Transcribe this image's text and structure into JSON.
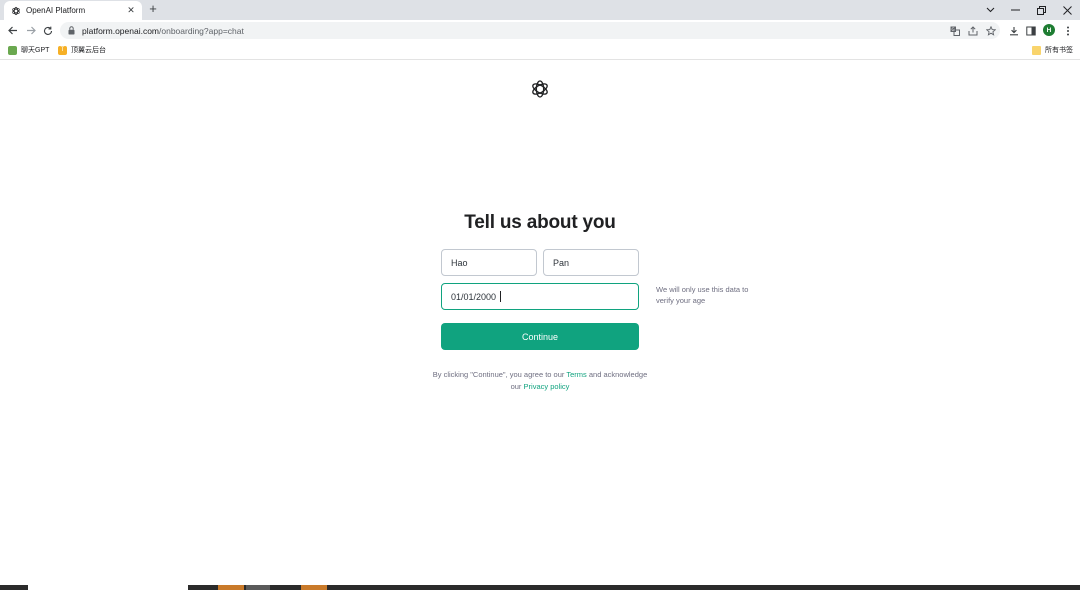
{
  "browser": {
    "tab": {
      "title": "OpenAI Platform"
    },
    "address": {
      "host": "platform.openai.com",
      "path": "/onboarding?app=chat"
    },
    "profile_initial": "H",
    "bookmarks": [
      {
        "label": "聊天GPT",
        "color": "#6aa84f"
      },
      {
        "label": "顶翼云后台",
        "color": "#f6b026"
      }
    ],
    "all_bookmarks_label": "所有书签"
  },
  "form": {
    "heading": "Tell us about you",
    "first_name": "Hao",
    "last_name": "Pan",
    "birthday": "01/01/2000",
    "birthday_hint": "We will only use this data to verify your age",
    "continue_label": "Continue",
    "legal": {
      "prefix": "By clicking \"Continue\", you agree to our",
      "terms": "Terms",
      "middle": "and acknowledge our",
      "privacy": "Privacy policy"
    }
  },
  "colors": {
    "accent": "#10a37f",
    "tabbar": "#dee1e6",
    "text": "#202123",
    "muted": "#6e6e80"
  },
  "icons": {
    "tab_favicon": "openai-logo-icon",
    "lock": "lock-icon",
    "translate": "translate-icon",
    "share": "share-icon",
    "star": "star-icon",
    "download": "download-icon",
    "side_panel": "side-panel-icon",
    "menu": "kebab-menu-icon"
  }
}
